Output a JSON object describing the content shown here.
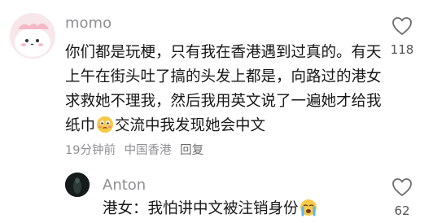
{
  "comment": {
    "username": "momo",
    "text_before_emoji": "你们都是玩梗，只有我在香港遇到过真的。有天上午在街头吐了搞的头发上都是，向路过的港女求救她不理我，然后我用英文说了一遍她才给我纸巾",
    "emoji_1": "flushed-face-emoji",
    "text_after_emoji": "交流中我发现她会中文",
    "time": "19分钟前",
    "location": "中国香港",
    "reply_label": "回复",
    "likes": "118",
    "heart_icon": "heart-outline-icon"
  },
  "reply": {
    "username": "Anton",
    "text": "港女：我怕讲中文被注销身份",
    "emoji": "crying-face-emoji",
    "likes": "62"
  },
  "colors": {
    "secondary_text": "#8e8e93",
    "primary_text": "#161616",
    "avatar_bg": "#f6e6ea"
  }
}
